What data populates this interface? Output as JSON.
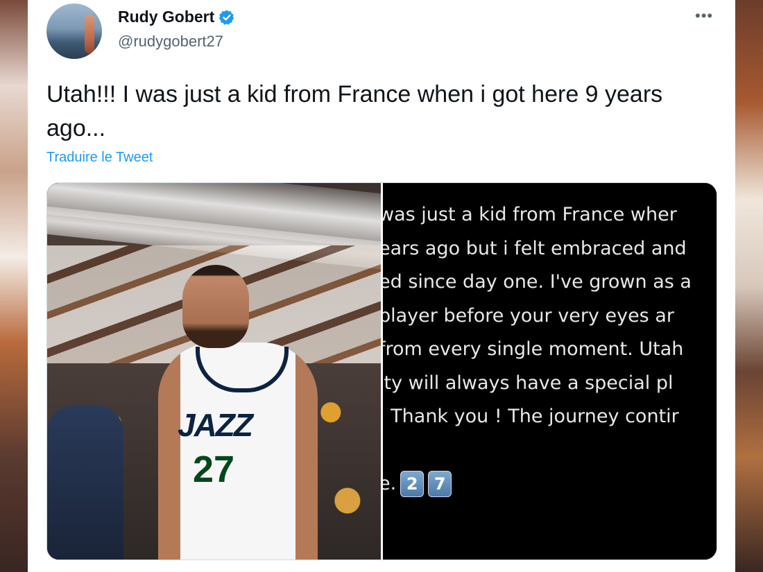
{
  "tweet": {
    "author_name": "Rudy Gobert",
    "handle": "@rudygobert27",
    "more_icon": "•••",
    "text": "Utah!!! I was just a kid from France when i got here 9 years ago...",
    "translate_label": "Traduire le Tweet"
  },
  "media": {
    "photo": {
      "jersey_logo": "JAZZ",
      "jersey_number": "27"
    },
    "note_lines": [
      "was just a kid from France wher",
      "ears ago but i felt embraced and",
      "ed since day one. I've grown as a",
      " player before your very eyes ar",
      " from every single moment. Utah",
      "ity will always have a special pl",
      ". Thank you ! The journey contir",
      "",
      "e."
    ],
    "keycaps": [
      "2",
      "7"
    ]
  },
  "colors": {
    "link": "#1d9bf0",
    "verified": "#1d9bf0",
    "text_primary": "#0f1419",
    "text_secondary": "#536471"
  },
  "icons": {
    "verified": "verified-badge-icon",
    "more": "more-horizontal-icon"
  }
}
